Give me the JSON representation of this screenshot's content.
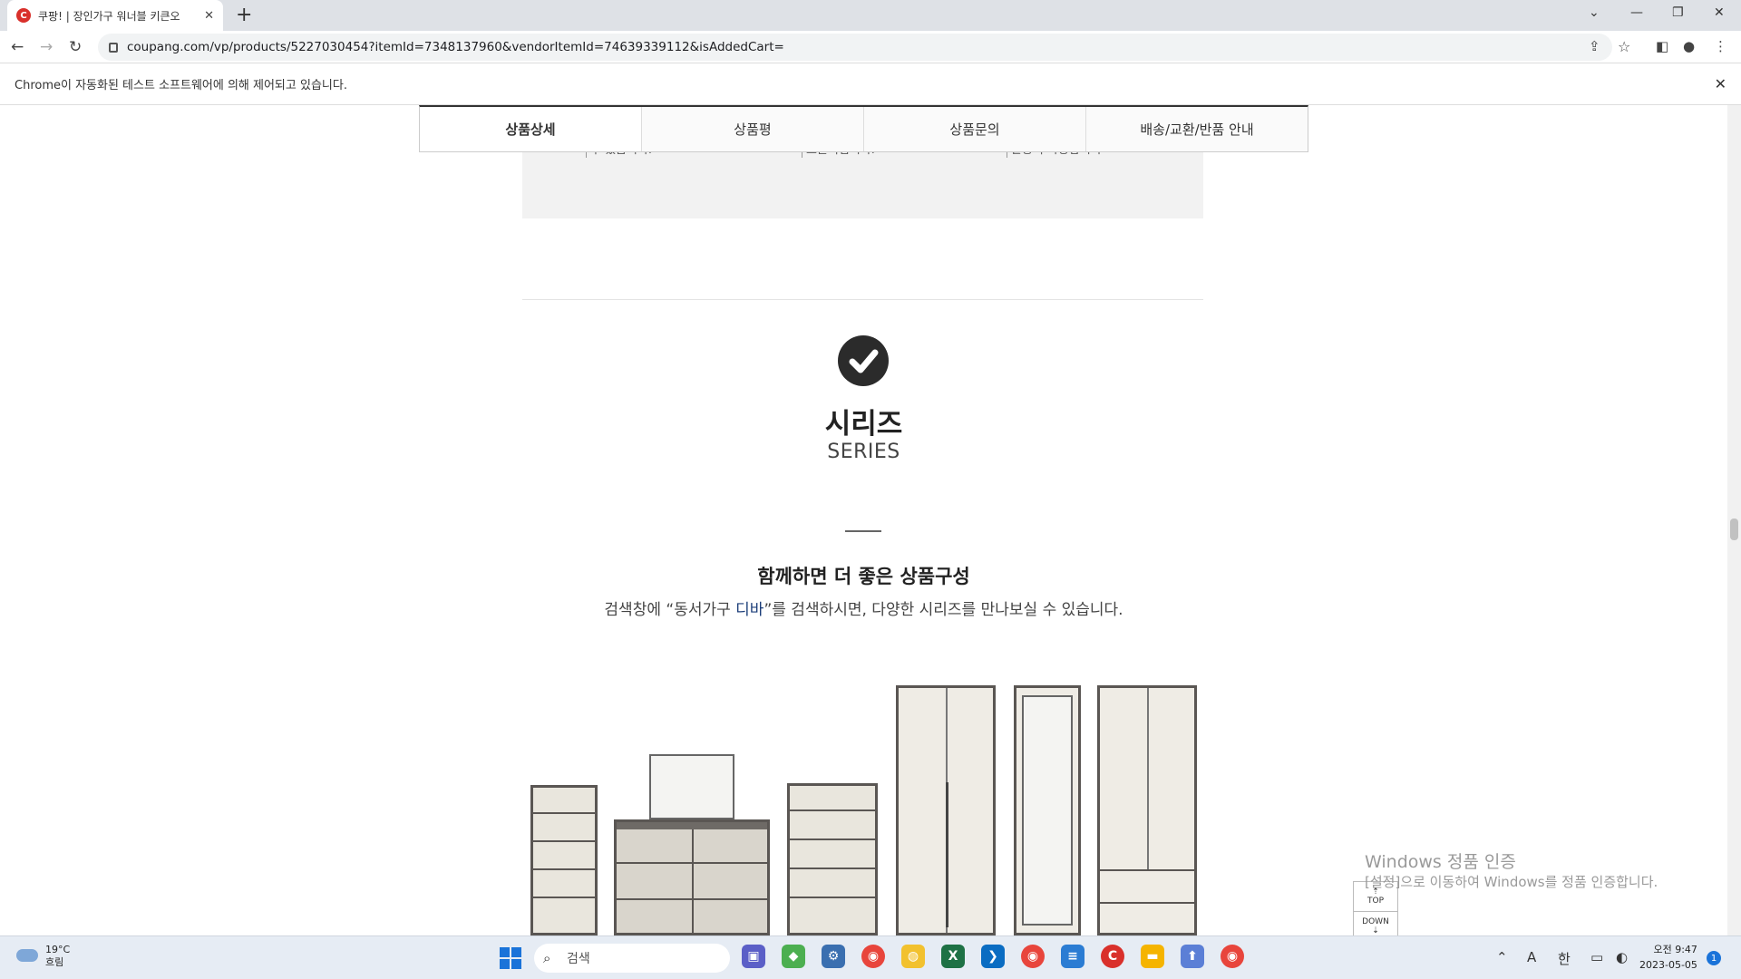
{
  "browser": {
    "tab_title": "쿠팡! | 장인가구 워너블 키큰오",
    "tab_favicon": "C",
    "url": "coupang.com/vp/products/5227030454?itemId=7348137960&vendorItemId=74639339112&isAddedCart=",
    "infobar_text": "Chrome이 자동화된 테스트 소프트웨어에 의해 제어되고 있습니다."
  },
  "product_tabs": [
    "상품상세",
    "상품평",
    "상품문의",
    "배송/교환/반품 안내"
  ],
  "feature_snippets": [
    "수 있습니다.",
    "효율적입니다.",
    "활용이 가능합니다"
  ],
  "series": {
    "title_ko": "시리즈",
    "title_en": "SERIES",
    "heading": "함께하면 더 좋은 상품구성",
    "desc_before": "검색창에 “동서가구 ",
    "desc_highlight": "디바",
    "desc_after": "”를 검색하시면, 다양한 시리즈를 만나보실 수 있습니다."
  },
  "scroll_helper": {
    "top": "TOP",
    "down": "DOWN"
  },
  "watermark": {
    "line1": "Windows 정품 인증",
    "line2": "[설정]으로 이동하여 Windows를 정품 인증합니다."
  },
  "taskbar": {
    "weather_temp": "19°C",
    "weather_desc": "흐림",
    "search_label": "검색",
    "tray_lang": "A",
    "tray_ime": "한",
    "time": "오전 9:47",
    "date": "2023-05-05",
    "notif_count": "1"
  },
  "colors": {
    "accent": "#1d3f7a",
    "coupang_red": "#d9302b"
  }
}
